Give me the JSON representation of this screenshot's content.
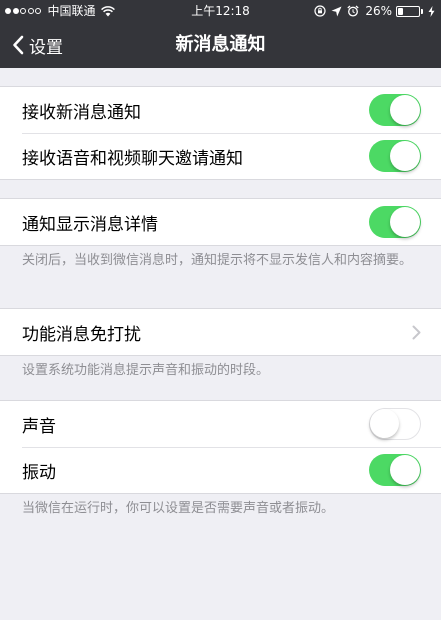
{
  "status_bar": {
    "signal_strength": 2,
    "signal_max": 5,
    "carrier": "中国联通",
    "time": "上午12:18",
    "battery_percent": "26%",
    "battery_level": 0.26,
    "icons": [
      "wifi-icon",
      "rotation-lock-icon",
      "location-icon",
      "alarm-icon",
      "charging-icon"
    ]
  },
  "nav": {
    "back_label": "设置",
    "title": "新消息通知"
  },
  "sections": {
    "new_message": {
      "items": [
        {
          "label": "接收新消息通知",
          "enabled": true
        },
        {
          "label": "接收语音和视频聊天邀请通知",
          "enabled": true
        }
      ]
    },
    "details": {
      "label": "通知显示消息详情",
      "enabled": true,
      "footnote": "关闭后，当收到微信消息时，通知提示将不显示发信人和内容摘要。"
    },
    "dnd": {
      "label": "功能消息免打扰",
      "footnote": "设置系统功能消息提示声音和振动的时段。"
    },
    "sound_vibration": {
      "items": [
        {
          "label": "声音",
          "enabled": false
        },
        {
          "label": "振动",
          "enabled": true
        }
      ],
      "footnote": "当微信在运行时，你可以设置是否需要声音或者振动。"
    }
  },
  "colors": {
    "nav_background": "#34353a",
    "page_background": "#efeff4",
    "toggle_on": "#4cd964",
    "footnote_text": "#8e8e93"
  }
}
